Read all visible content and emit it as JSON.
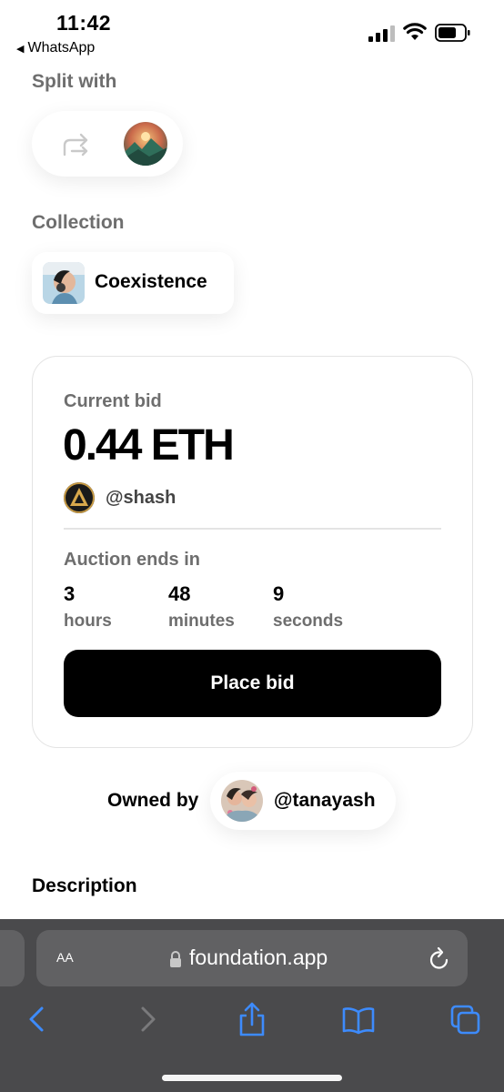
{
  "status_bar": {
    "time": "11:42",
    "back_app": "WhatsApp"
  },
  "split": {
    "label": "Split with"
  },
  "collection": {
    "label": "Collection",
    "name": "Coexistence"
  },
  "bid": {
    "label": "Current bid",
    "amount": "0.44 ETH",
    "bidder": "@shash",
    "auction_label": "Auction ends in",
    "countdown": [
      {
        "value": "3",
        "unit": "hours"
      },
      {
        "value": "48",
        "unit": "minutes"
      },
      {
        "value": "9",
        "unit": "seconds"
      }
    ],
    "button_label": "Place bid"
  },
  "owner": {
    "label": "Owned by",
    "handle": "@tanayash"
  },
  "description": {
    "label": "Description"
  },
  "browser": {
    "text_size_label": "AA",
    "url": "foundation.app",
    "accent_color": "#3d8bfd",
    "toolbar_color": "#4a4a4c"
  }
}
